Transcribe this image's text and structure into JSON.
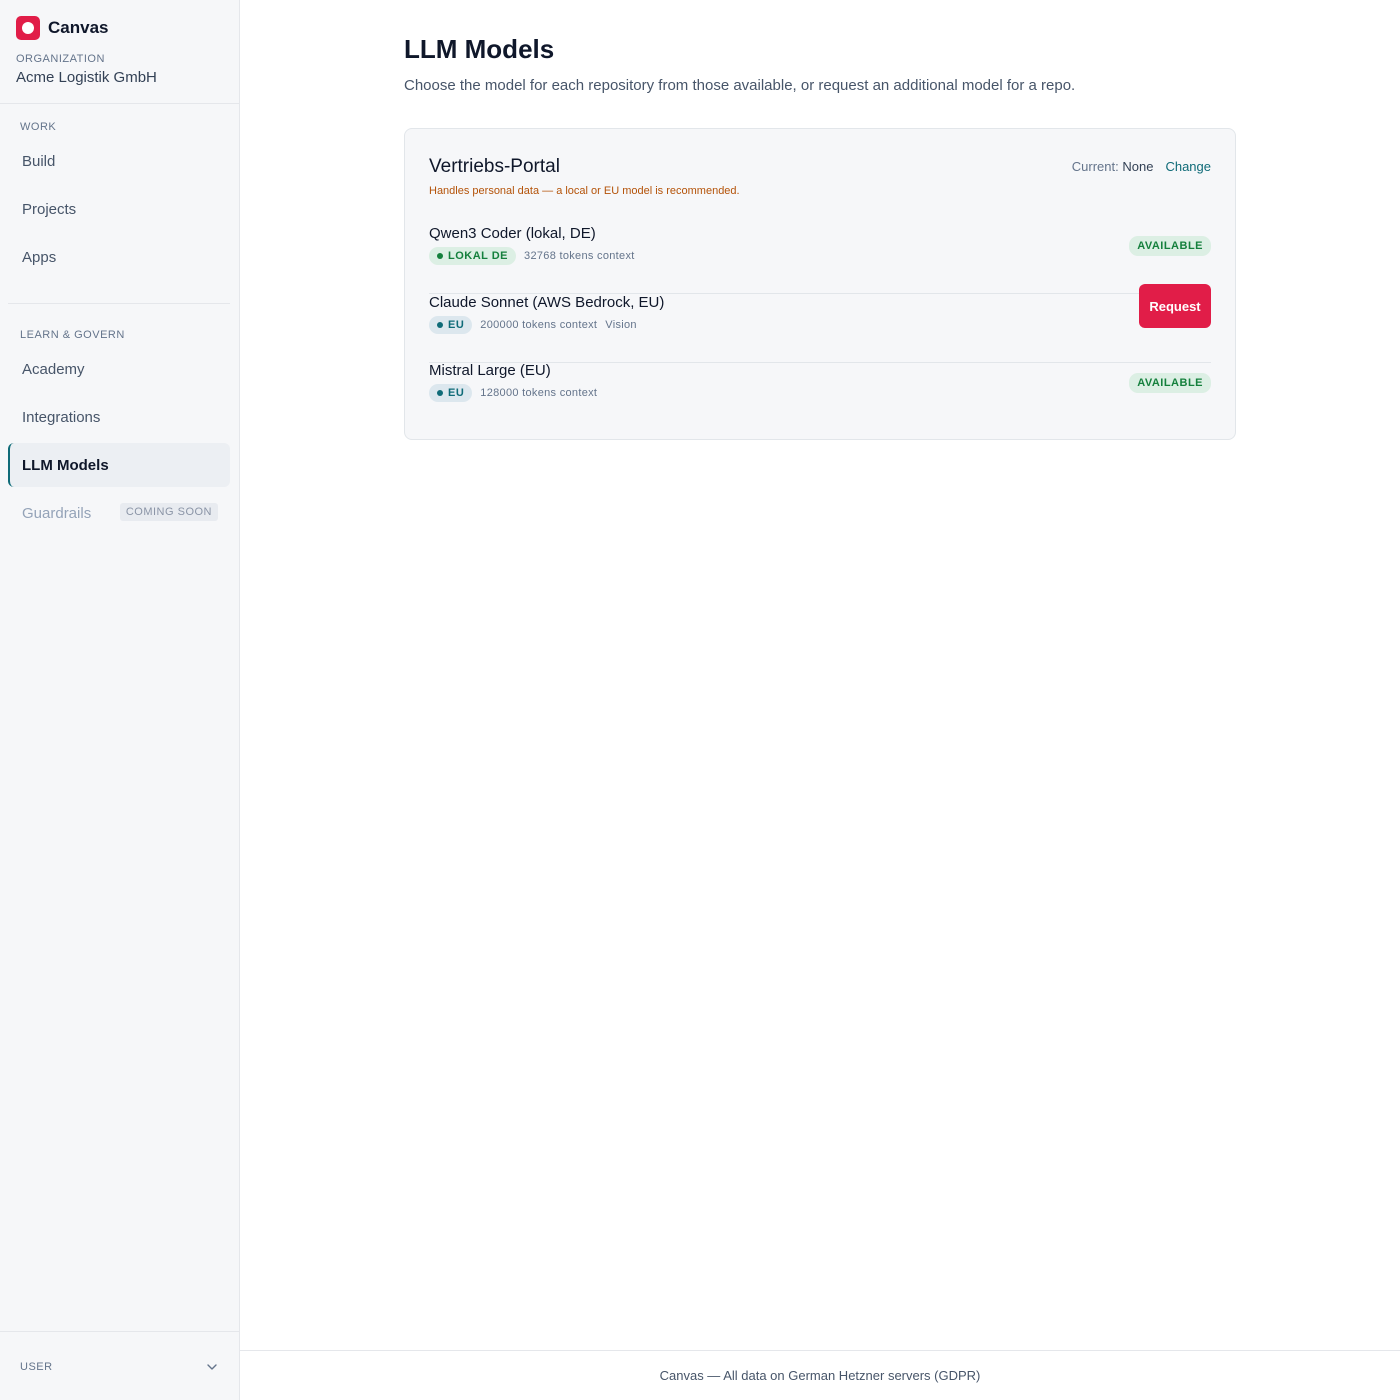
{
  "app": {
    "name": "Canvas"
  },
  "org": {
    "label": "ORGANIZATION",
    "name": "Acme Logistik GmbH"
  },
  "sidebar": {
    "sections": [
      {
        "label": "WORK",
        "items": [
          {
            "label": "Build"
          },
          {
            "label": "Projects"
          },
          {
            "label": "Apps"
          }
        ]
      },
      {
        "label": "LEARN & GOVERN",
        "items": [
          {
            "label": "Academy"
          },
          {
            "label": "Integrations"
          },
          {
            "label": "LLM Models",
            "active": true
          },
          {
            "label": "Guardrails",
            "badge": "COMING SOON",
            "disabled": true
          }
        ]
      }
    ],
    "user_label": "USER"
  },
  "page": {
    "title": "LLM Models",
    "subtitle": "Choose the model for each repository from those available, or request an additional model for a repo."
  },
  "repo": {
    "name": "Vertriebs-Portal",
    "warning": "Handles personal data — a local or EU model is recommended.",
    "current_label": "Current:",
    "current_value": "None",
    "change_label": "Change",
    "models": [
      {
        "name": "Qwen3 Coder (lokal, DE)",
        "region": "LOKAL DE",
        "context": "32768 tokens context",
        "extra": "",
        "status": "AVAILABLE"
      },
      {
        "name": "Claude Sonnet (AWS Bedrock, EU)",
        "region": "EU",
        "context": "200000 tokens context",
        "extra": "Vision",
        "action": "Request"
      },
      {
        "name": "Mistral Large (EU)",
        "region": "EU",
        "context": "128000 tokens context",
        "extra": "",
        "status": "AVAILABLE"
      }
    ]
  },
  "footer": {
    "text": "Canvas — All data on German Hetzner servers (GDPR)"
  },
  "colors": {
    "accent": "#e11d48",
    "teal": "#0f6b78",
    "green": "#15803d",
    "warning": "#b45309"
  }
}
